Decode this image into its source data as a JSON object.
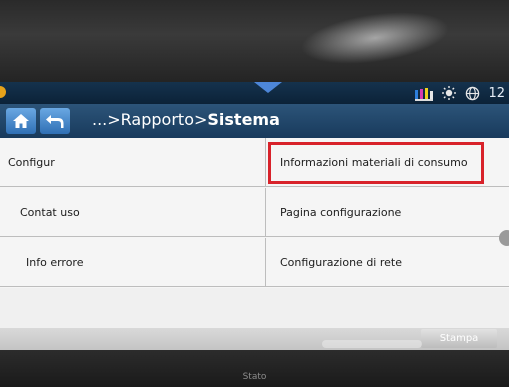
{
  "header": {
    "breadcrumb_prefix": "...>Rapporto>",
    "breadcrumb_current": "Sistema",
    "status_clock": "12"
  },
  "menu": {
    "left": [
      "Configur",
      "Contat uso",
      "Info errore"
    ],
    "right": [
      "Informazioni materiali di consumo",
      "Pagina configurazione",
      "Configurazione di rete"
    ]
  },
  "footer": {
    "print_button": "Stampa"
  },
  "device": {
    "status_label": "Stato"
  },
  "colors": {
    "highlight": "#d8222a",
    "accent": "#4d86d8"
  }
}
